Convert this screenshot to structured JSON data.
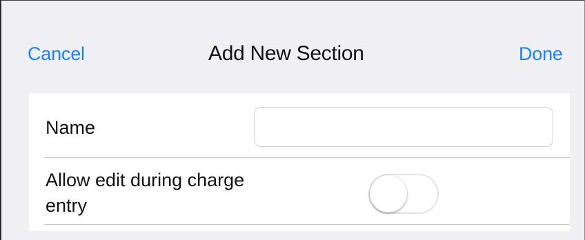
{
  "navbar": {
    "cancel_label": "Cancel",
    "title": "Add New Section",
    "done_label": "Done"
  },
  "form": {
    "name_label": "Name",
    "name_value": "",
    "name_placeholder": "",
    "allow_edit_label": "Allow edit during charge entry",
    "allow_edit_enabled": false
  },
  "colors": {
    "accent": "#1a82fb",
    "background": "#efeff4",
    "separator": "#c8c7cc"
  }
}
